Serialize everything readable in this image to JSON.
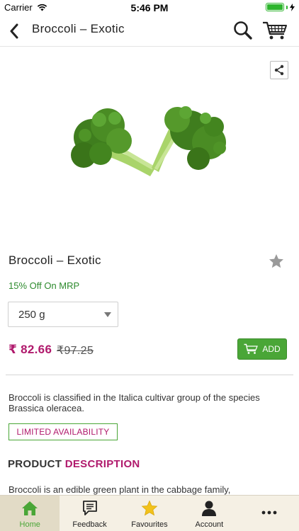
{
  "status_bar": {
    "carrier": "Carrier",
    "time": "5:46 PM"
  },
  "nav": {
    "title": "Broccoli  –  Exotic",
    "icons": [
      "back-chevron-icon",
      "search-icon",
      "cart-icon"
    ]
  },
  "product": {
    "name": "Broccoli  –  Exotic",
    "discount": "15% Off On MRP",
    "quantity_selected": "250 g",
    "price": "₹ 82.66",
    "mrp": "₹97.25",
    "add_label": "ADD",
    "short_description": "Broccoli is classified in the Italica cultivar group of the species Brassica oleracea.",
    "availability": "LIMITED AVAILABILITY"
  },
  "description_section": {
    "title_part1": "PRODUCT ",
    "title_part2": "DESCRIPTION",
    "text": "Broccoli is an edible green plant in the cabbage family,"
  },
  "tabs": [
    {
      "label": "Home",
      "icon": "home-icon",
      "active": true
    },
    {
      "label": "Feedback",
      "icon": "feedback-icon",
      "active": false
    },
    {
      "label": "Favourites",
      "icon": "star-icon",
      "active": false
    },
    {
      "label": "Account",
      "icon": "account-icon",
      "active": false
    },
    {
      "label": "",
      "icon": "more-icon",
      "active": false
    }
  ],
  "colors": {
    "accent_green": "#4aa637",
    "price_magenta": "#b0196c",
    "tab_bar_bg": "#f5f0e4"
  }
}
